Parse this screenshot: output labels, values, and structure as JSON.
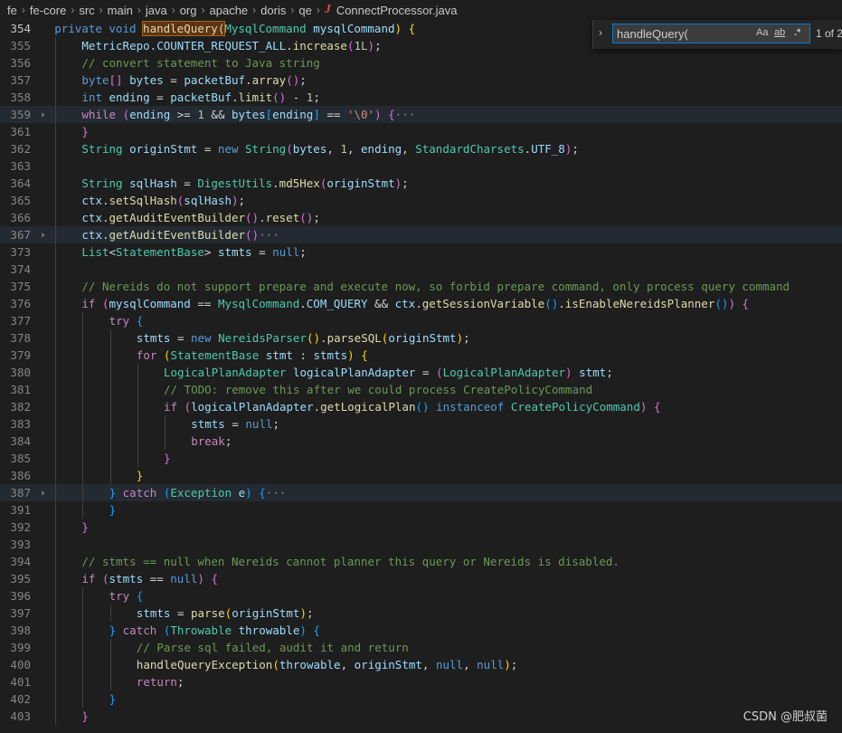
{
  "breadcrumb": {
    "items": [
      "fe",
      "fe-core",
      "src",
      "main",
      "java",
      "org",
      "apache",
      "doris",
      "qe"
    ],
    "file_icon": "J",
    "file": "ConnectProcessor.java"
  },
  "find_widget": {
    "query": "handleQuery(",
    "match_case_label": "Aa",
    "whole_word_label": "ab",
    "regex_label": ".*",
    "count": "1 of 2"
  },
  "lines": [
    {
      "n": "354",
      "indent": 1,
      "segs": [
        [
          "k",
          "private"
        ],
        [
          "p",
          " "
        ],
        [
          "k",
          "void"
        ],
        [
          "p",
          " "
        ],
        [
          "fm",
          "handleQuery("
        ],
        [
          "t",
          "MysqlCommand"
        ],
        [
          "p",
          " "
        ],
        [
          "v",
          "mysqlCommand"
        ],
        [
          "b1",
          ")"
        ],
        [
          "p",
          " "
        ],
        [
          "b1",
          "{"
        ]
      ]
    },
    {
      "n": "355",
      "indent": 2,
      "segs": [
        [
          "v",
          "MetricRepo"
        ],
        [
          "p",
          "."
        ],
        [
          "v",
          "COUNTER_REQUEST_ALL"
        ],
        [
          "p",
          "."
        ],
        [
          "f",
          "increase"
        ],
        [
          "b2",
          "("
        ],
        [
          "n",
          "1L"
        ],
        [
          "b2",
          ")"
        ],
        [
          "p",
          ";"
        ]
      ]
    },
    {
      "n": "356",
      "indent": 2,
      "segs": [
        [
          "c",
          "// convert statement to Java string"
        ]
      ]
    },
    {
      "n": "357",
      "indent": 2,
      "segs": [
        [
          "k",
          "byte"
        ],
        [
          "b2",
          "[]"
        ],
        [
          "p",
          " "
        ],
        [
          "v",
          "bytes"
        ],
        [
          "p",
          " = "
        ],
        [
          "v",
          "packetBuf"
        ],
        [
          "p",
          "."
        ],
        [
          "f",
          "array"
        ],
        [
          "b2",
          "()"
        ],
        [
          "p",
          ";"
        ]
      ]
    },
    {
      "n": "358",
      "indent": 2,
      "segs": [
        [
          "k",
          "int"
        ],
        [
          "p",
          " "
        ],
        [
          "v",
          "ending"
        ],
        [
          "p",
          " = "
        ],
        [
          "v",
          "packetBuf"
        ],
        [
          "p",
          "."
        ],
        [
          "f",
          "limit"
        ],
        [
          "b2",
          "()"
        ],
        [
          "p",
          " - "
        ],
        [
          "n",
          "1"
        ],
        [
          "p",
          ";"
        ]
      ]
    },
    {
      "n": "359",
      "indent": 2,
      "fold": true,
      "hl": true,
      "segs": [
        [
          "kc",
          "while"
        ],
        [
          "p",
          " "
        ],
        [
          "b2",
          "("
        ],
        [
          "v",
          "ending"
        ],
        [
          "p",
          " >= "
        ],
        [
          "n",
          "1"
        ],
        [
          "p",
          " && "
        ],
        [
          "v",
          "bytes"
        ],
        [
          "b3",
          "["
        ],
        [
          "v",
          "ending"
        ],
        [
          "b3",
          "]"
        ],
        [
          "p",
          " == "
        ],
        [
          "s",
          "'\\0'"
        ],
        [
          "b2",
          ")"
        ],
        [
          "p",
          " "
        ],
        [
          "b2",
          "{"
        ],
        [
          "dots",
          "···"
        ]
      ]
    },
    {
      "n": "361",
      "indent": 2,
      "segs": [
        [
          "b2",
          "}"
        ]
      ]
    },
    {
      "n": "362",
      "indent": 2,
      "segs": [
        [
          "t",
          "String"
        ],
        [
          "p",
          " "
        ],
        [
          "v",
          "originStmt"
        ],
        [
          "p",
          " = "
        ],
        [
          "k",
          "new"
        ],
        [
          "p",
          " "
        ],
        [
          "t",
          "String"
        ],
        [
          "b2",
          "("
        ],
        [
          "v",
          "bytes"
        ],
        [
          "p",
          ", "
        ],
        [
          "n",
          "1"
        ],
        [
          "p",
          ", "
        ],
        [
          "v",
          "ending"
        ],
        [
          "p",
          ", "
        ],
        [
          "t",
          "StandardCharsets"
        ],
        [
          "p",
          "."
        ],
        [
          "v",
          "UTF_8"
        ],
        [
          "b2",
          ")"
        ],
        [
          "p",
          ";"
        ]
      ]
    },
    {
      "n": "363",
      "indent": 2,
      "segs": []
    },
    {
      "n": "364",
      "indent": 2,
      "segs": [
        [
          "t",
          "String"
        ],
        [
          "p",
          " "
        ],
        [
          "v",
          "sqlHash"
        ],
        [
          "p",
          " = "
        ],
        [
          "t",
          "DigestUtils"
        ],
        [
          "p",
          "."
        ],
        [
          "f",
          "md5Hex"
        ],
        [
          "b2",
          "("
        ],
        [
          "v",
          "originStmt"
        ],
        [
          "b2",
          ")"
        ],
        [
          "p",
          ";"
        ]
      ]
    },
    {
      "n": "365",
      "indent": 2,
      "segs": [
        [
          "v",
          "ctx"
        ],
        [
          "p",
          "."
        ],
        [
          "f",
          "setSqlHash"
        ],
        [
          "b2",
          "("
        ],
        [
          "v",
          "sqlHash"
        ],
        [
          "b2",
          ")"
        ],
        [
          "p",
          ";"
        ]
      ]
    },
    {
      "n": "366",
      "indent": 2,
      "segs": [
        [
          "v",
          "ctx"
        ],
        [
          "p",
          "."
        ],
        [
          "f",
          "getAuditEventBuilder"
        ],
        [
          "b2",
          "()"
        ],
        [
          "p",
          "."
        ],
        [
          "f",
          "reset"
        ],
        [
          "b2",
          "()"
        ],
        [
          "p",
          ";"
        ]
      ]
    },
    {
      "n": "367",
      "indent": 2,
      "fold": true,
      "hl": true,
      "segs": [
        [
          "v",
          "ctx"
        ],
        [
          "p",
          "."
        ],
        [
          "f",
          "getAuditEventBuilder"
        ],
        [
          "b2",
          "()"
        ],
        [
          "dots",
          "···"
        ]
      ]
    },
    {
      "n": "373",
      "indent": 2,
      "segs": [
        [
          "t",
          "List"
        ],
        [
          "p",
          "<"
        ],
        [
          "t",
          "StatementBase"
        ],
        [
          "p",
          "> "
        ],
        [
          "v",
          "stmts"
        ],
        [
          "p",
          " = "
        ],
        [
          "k",
          "null"
        ],
        [
          "p",
          ";"
        ]
      ]
    },
    {
      "n": "374",
      "indent": 2,
      "segs": []
    },
    {
      "n": "375",
      "indent": 2,
      "segs": [
        [
          "c",
          "// Nereids do not support prepare and execute now, so forbid prepare command, only process query command"
        ]
      ]
    },
    {
      "n": "376",
      "indent": 2,
      "segs": [
        [
          "kc",
          "if"
        ],
        [
          "p",
          " "
        ],
        [
          "b2",
          "("
        ],
        [
          "v",
          "mysqlCommand"
        ],
        [
          "p",
          " == "
        ],
        [
          "t",
          "MysqlCommand"
        ],
        [
          "p",
          "."
        ],
        [
          "v",
          "COM_QUERY"
        ],
        [
          "p",
          " && "
        ],
        [
          "v",
          "ctx"
        ],
        [
          "p",
          "."
        ],
        [
          "f",
          "getSessionVariable"
        ],
        [
          "b3",
          "()"
        ],
        [
          "p",
          "."
        ],
        [
          "f",
          "isEnableNereidsPlanner"
        ],
        [
          "b3",
          "()"
        ],
        [
          "b2",
          ")"
        ],
        [
          "p",
          " "
        ],
        [
          "b2",
          "{"
        ]
      ]
    },
    {
      "n": "377",
      "indent": 3,
      "segs": [
        [
          "kc",
          "try"
        ],
        [
          "p",
          " "
        ],
        [
          "b3",
          "{"
        ]
      ]
    },
    {
      "n": "378",
      "indent": 4,
      "segs": [
        [
          "v",
          "stmts"
        ],
        [
          "p",
          " = "
        ],
        [
          "k",
          "new"
        ],
        [
          "p",
          " "
        ],
        [
          "t",
          "NereidsParser"
        ],
        [
          "b1",
          "()"
        ],
        [
          "p",
          "."
        ],
        [
          "f",
          "parseSQL"
        ],
        [
          "b1",
          "("
        ],
        [
          "v",
          "originStmt"
        ],
        [
          "b1",
          ")"
        ],
        [
          "p",
          ";"
        ]
      ]
    },
    {
      "n": "379",
      "indent": 4,
      "segs": [
        [
          "kc",
          "for"
        ],
        [
          "p",
          " "
        ],
        [
          "b1",
          "("
        ],
        [
          "t",
          "StatementBase"
        ],
        [
          "p",
          " "
        ],
        [
          "v",
          "stmt"
        ],
        [
          "p",
          " : "
        ],
        [
          "v",
          "stmts"
        ],
        [
          "b1",
          ")"
        ],
        [
          "p",
          " "
        ],
        [
          "b1",
          "{"
        ]
      ]
    },
    {
      "n": "380",
      "indent": 5,
      "segs": [
        [
          "t",
          "LogicalPlanAdapter"
        ],
        [
          "p",
          " "
        ],
        [
          "v",
          "logicalPlanAdapter"
        ],
        [
          "p",
          " = "
        ],
        [
          "b2",
          "("
        ],
        [
          "t",
          "LogicalPlanAdapter"
        ],
        [
          "b2",
          ")"
        ],
        [
          "p",
          " "
        ],
        [
          "v",
          "stmt"
        ],
        [
          "p",
          ";"
        ]
      ]
    },
    {
      "n": "381",
      "indent": 5,
      "segs": [
        [
          "c",
          "// TODO: remove this after we could process CreatePolicyCommand"
        ]
      ]
    },
    {
      "n": "382",
      "indent": 5,
      "segs": [
        [
          "kc",
          "if"
        ],
        [
          "p",
          " "
        ],
        [
          "b2",
          "("
        ],
        [
          "v",
          "logicalPlanAdapter"
        ],
        [
          "p",
          "."
        ],
        [
          "f",
          "getLogicalPlan"
        ],
        [
          "b3",
          "()"
        ],
        [
          "p",
          " "
        ],
        [
          "k",
          "instanceof"
        ],
        [
          "p",
          " "
        ],
        [
          "t",
          "CreatePolicyCommand"
        ],
        [
          "b2",
          ")"
        ],
        [
          "p",
          " "
        ],
        [
          "b2",
          "{"
        ]
      ]
    },
    {
      "n": "383",
      "indent": 6,
      "segs": [
        [
          "v",
          "stmts"
        ],
        [
          "p",
          " = "
        ],
        [
          "k",
          "null"
        ],
        [
          "p",
          ";"
        ]
      ]
    },
    {
      "n": "384",
      "indent": 6,
      "segs": [
        [
          "kc",
          "break"
        ],
        [
          "p",
          ";"
        ]
      ]
    },
    {
      "n": "385",
      "indent": 5,
      "segs": [
        [
          "b2",
          "}"
        ]
      ]
    },
    {
      "n": "386",
      "indent": 4,
      "segs": [
        [
          "b1",
          "}"
        ]
      ]
    },
    {
      "n": "387",
      "indent": 3,
      "fold": true,
      "hl": true,
      "segs": [
        [
          "b3",
          "}"
        ],
        [
          "p",
          " "
        ],
        [
          "kc",
          "catch"
        ],
        [
          "p",
          " "
        ],
        [
          "b3",
          "("
        ],
        [
          "t",
          "Exception"
        ],
        [
          "p",
          " "
        ],
        [
          "v",
          "e"
        ],
        [
          "b3",
          ")"
        ],
        [
          "p",
          " "
        ],
        [
          "b3",
          "{"
        ],
        [
          "dots",
          "···"
        ]
      ]
    },
    {
      "n": "391",
      "indent": 3,
      "segs": [
        [
          "b3",
          "}"
        ]
      ]
    },
    {
      "n": "392",
      "indent": 2,
      "segs": [
        [
          "b2",
          "}"
        ]
      ]
    },
    {
      "n": "393",
      "indent": 2,
      "segs": []
    },
    {
      "n": "394",
      "indent": 2,
      "segs": [
        [
          "c",
          "// stmts == null when Nereids cannot planner this query or Nereids is disabled."
        ]
      ]
    },
    {
      "n": "395",
      "indent": 2,
      "segs": [
        [
          "kc",
          "if"
        ],
        [
          "p",
          " "
        ],
        [
          "b2",
          "("
        ],
        [
          "v",
          "stmts"
        ],
        [
          "p",
          " == "
        ],
        [
          "k",
          "null"
        ],
        [
          "b2",
          ")"
        ],
        [
          "p",
          " "
        ],
        [
          "b2",
          "{"
        ]
      ]
    },
    {
      "n": "396",
      "indent": 3,
      "segs": [
        [
          "kc",
          "try"
        ],
        [
          "p",
          " "
        ],
        [
          "b3",
          "{"
        ]
      ]
    },
    {
      "n": "397",
      "indent": 4,
      "segs": [
        [
          "v",
          "stmts"
        ],
        [
          "p",
          " = "
        ],
        [
          "f",
          "parse"
        ],
        [
          "b1",
          "("
        ],
        [
          "v",
          "originStmt"
        ],
        [
          "b1",
          ")"
        ],
        [
          "p",
          ";"
        ]
      ]
    },
    {
      "n": "398",
      "indent": 3,
      "segs": [
        [
          "b3",
          "}"
        ],
        [
          "p",
          " "
        ],
        [
          "kc",
          "catch"
        ],
        [
          "p",
          " "
        ],
        [
          "b3",
          "("
        ],
        [
          "t",
          "Throwable"
        ],
        [
          "p",
          " "
        ],
        [
          "v",
          "throwable"
        ],
        [
          "b3",
          ")"
        ],
        [
          "p",
          " "
        ],
        [
          "b3",
          "{"
        ]
      ]
    },
    {
      "n": "399",
      "indent": 4,
      "segs": [
        [
          "c",
          "// Parse sql failed, audit it and return"
        ]
      ]
    },
    {
      "n": "400",
      "indent": 4,
      "segs": [
        [
          "f",
          "handleQueryException"
        ],
        [
          "b1",
          "("
        ],
        [
          "v",
          "throwable"
        ],
        [
          "p",
          ", "
        ],
        [
          "v",
          "originStmt"
        ],
        [
          "p",
          ", "
        ],
        [
          "k",
          "null"
        ],
        [
          "p",
          ", "
        ],
        [
          "k",
          "null"
        ],
        [
          "b1",
          ")"
        ],
        [
          "p",
          ";"
        ]
      ]
    },
    {
      "n": "401",
      "indent": 4,
      "segs": [
        [
          "kc",
          "return"
        ],
        [
          "p",
          ";"
        ]
      ]
    },
    {
      "n": "402",
      "indent": 3,
      "segs": [
        [
          "b3",
          "}"
        ]
      ]
    },
    {
      "n": "403",
      "indent": 2,
      "segs": [
        [
          "b2",
          "}"
        ]
      ]
    }
  ],
  "watermark": "CSDN @肥叔菌",
  "colors": {
    "background": "#1e1e1e",
    "keyword": "#569cd6",
    "control": "#c586c0",
    "type": "#4ec9b0",
    "function": "#dcdcaa",
    "variable": "#9cdcfe",
    "number": "#b5cea8",
    "string": "#ce9178",
    "comment": "#6a9955",
    "find_match": "#613214"
  }
}
